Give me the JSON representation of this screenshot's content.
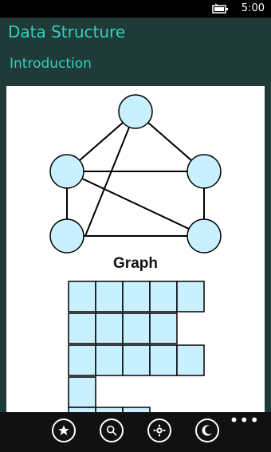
{
  "status": {
    "time": "5:00"
  },
  "header": {
    "app_title": "Data Structure",
    "section_title": "Introduction"
  },
  "figure": {
    "graph_label": "Graph"
  },
  "appbar": {
    "buttons": [
      "star-icon",
      "search-icon",
      "settings-icon",
      "moon-icon"
    ],
    "more": "•••"
  }
}
